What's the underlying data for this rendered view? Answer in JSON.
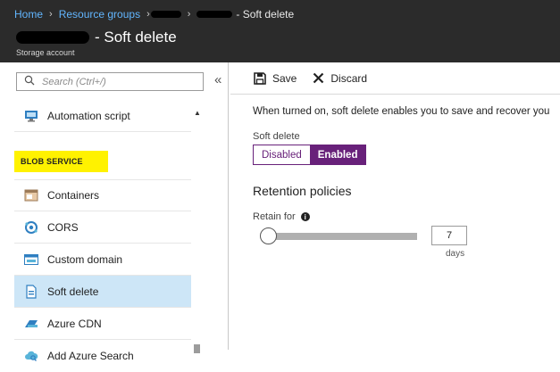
{
  "header": {
    "breadcrumb": {
      "home": "Home",
      "resource_groups": "Resource groups",
      "current_suffix": " - Soft delete"
    },
    "title": "- Soft delete",
    "subtitle": "Storage account"
  },
  "sidebar": {
    "search_placeholder": "Search (Ctrl+/)",
    "collapse": "«",
    "items_before": [
      {
        "label": "Automation script",
        "icon": "automation-script-icon"
      }
    ],
    "section_label": "BLOB SERVICE",
    "items": [
      {
        "label": "Containers",
        "icon": "containers-icon",
        "selected": false
      },
      {
        "label": "CORS",
        "icon": "cors-icon",
        "selected": false
      },
      {
        "label": "Custom domain",
        "icon": "custom-domain-icon",
        "selected": false
      },
      {
        "label": "Soft delete",
        "icon": "soft-delete-icon",
        "selected": true
      },
      {
        "label": "Azure CDN",
        "icon": "azure-cdn-icon",
        "selected": false
      },
      {
        "label": "Add Azure Search",
        "icon": "azure-search-icon",
        "selected": false
      }
    ]
  },
  "toolbar": {
    "save_label": "Save",
    "discard_label": "Discard"
  },
  "main": {
    "description": "When turned on, soft delete enables you to save and recover you",
    "soft_delete_label": "Soft delete",
    "toggle": {
      "off_label": "Disabled",
      "on_label": "Enabled",
      "value": "Enabled"
    },
    "retention_heading": "Retention policies",
    "retain_for_label": "Retain for",
    "retain_days_value": "7",
    "retain_unit": "days",
    "slider_fraction": 0.0
  },
  "colors": {
    "header_bg": "#2b2b2b",
    "accent_purple": "#68217a",
    "link_blue": "#62b6ff",
    "selected_bg": "#cde6f7",
    "highlight_yellow": "#fff200"
  }
}
